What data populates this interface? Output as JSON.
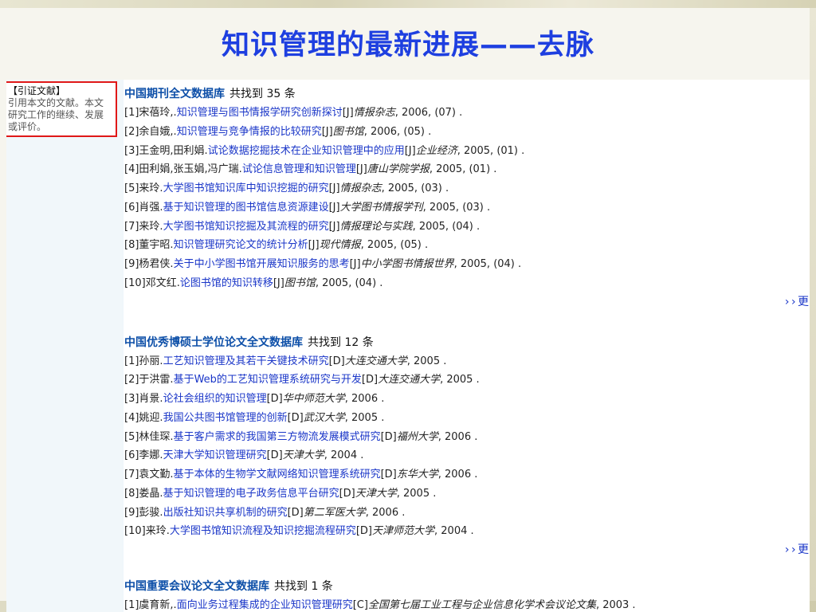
{
  "slide": {
    "title": "知识管理的最新进展——去脉"
  },
  "callout": {
    "title": "【引证文献】",
    "text": "引用本文的文献。本文研究工作的继续、发展或评价。"
  },
  "sections": [
    {
      "db_name": "中国期刊全文数据库",
      "found": "共找到 35 条",
      "items": [
        {
          "n": "[1]",
          "author": "宋蓓玲,.",
          "title": "知识管理与图书情报学研究创新探讨",
          "type": "[J]",
          "source": "情报杂志",
          "year": ", 2006, (07) ."
        },
        {
          "n": "[2]",
          "author": "余自娥,.",
          "title": "知识管理与竞争情报的比较研究",
          "type": "[J]",
          "source": "图书馆",
          "year": ", 2006, (05) ."
        },
        {
          "n": "[3]",
          "author": "王金明,田利娟.",
          "title": "试论数据挖掘技术在企业知识管理中的应用",
          "type": "[J]",
          "source": "企业经济",
          "year": ", 2005, (01) ."
        },
        {
          "n": "[4]",
          "author": "田利娟,张玉娟,冯广瑞.",
          "title": "试论信息管理和知识管理",
          "type": "[J]",
          "source": "唐山学院学报",
          "year": ", 2005, (01) ."
        },
        {
          "n": "[5]",
          "author": "来玲.",
          "title": "大学图书馆知识库中知识挖掘的研究",
          "type": "[J]",
          "source": "情报杂志",
          "year": ", 2005, (03) ."
        },
        {
          "n": "[6]",
          "author": "肖强.",
          "title": "基于知识管理的图书馆信息资源建设",
          "type": "[J]",
          "source": "大学图书情报学刊",
          "year": ", 2005, (03) ."
        },
        {
          "n": "[7]",
          "author": "来玲.",
          "title": "大学图书馆知识挖掘及其流程的研究",
          "type": "[J]",
          "source": "情报理论与实践",
          "year": ", 2005, (04) ."
        },
        {
          "n": "[8]",
          "author": "董宇昭.",
          "title": "知识管理研究论文的统计分析",
          "type": "[J]",
          "source": "现代情报",
          "year": ", 2005, (05) ."
        },
        {
          "n": "[9]",
          "author": "杨君侠.",
          "title": "关于中小学图书馆开展知识服务的思考",
          "type": "[J]",
          "source": "中小学图书情报世界",
          "year": ", 2005, (04) ."
        },
        {
          "n": "[10]",
          "author": "邓文红.",
          "title": "论图书馆的知识转移",
          "type": "[J]",
          "source": "图书馆",
          "year": ", 2005, (04) ."
        }
      ],
      "more": "› › 更"
    },
    {
      "db_name": "中国优秀博硕士学位论文全文数据库",
      "found": "共找到 12 条",
      "items": [
        {
          "n": "[1]",
          "author": "孙丽.",
          "title": "工艺知识管理及其若干关键技术研究",
          "type": "[D]",
          "source": "大连交通大学",
          "year": ", 2005 ."
        },
        {
          "n": "[2]",
          "author": "于洪雷.",
          "title": "基于Web的工艺知识管理系统研究与开发",
          "type": "[D]",
          "source": "大连交通大学",
          "year": ", 2005 ."
        },
        {
          "n": "[3]",
          "author": "肖景.",
          "title": "论社会组织的知识管理",
          "type": "[D]",
          "source": "华中师范大学",
          "year": ", 2006 ."
        },
        {
          "n": "[4]",
          "author": "姚迎.",
          "title": "我国公共图书馆管理的创新",
          "type": "[D]",
          "source": "武汉大学",
          "year": ", 2005 ."
        },
        {
          "n": "[5]",
          "author": "林佳琛.",
          "title": "基于客户需求的我国第三方物流发展模式研究",
          "type": "[D]",
          "source": "福州大学",
          "year": ", 2006 ."
        },
        {
          "n": "[6]",
          "author": "李娜.",
          "title": "天津大学知识管理研究",
          "type": "[D]",
          "source": "天津大学",
          "year": ", 2004 ."
        },
        {
          "n": "[7]",
          "author": "袁文勤.",
          "title": "基于本体的生物学文献网络知识管理系统研究",
          "type": "[D]",
          "source": "东华大学",
          "year": ", 2006 ."
        },
        {
          "n": "[8]",
          "author": "娄晶.",
          "title": "基于知识管理的电子政务信息平台研究",
          "type": "[D]",
          "source": "天津大学",
          "year": ", 2005 ."
        },
        {
          "n": "[9]",
          "author": "彭骏.",
          "title": "出版社知识共享机制的研究",
          "type": "[D]",
          "source": "第二军医大学",
          "year": ", 2006 ."
        },
        {
          "n": "[10]",
          "author": "来玲.",
          "title": "大学图书馆知识流程及知识挖掘流程研究",
          "type": "[D]",
          "source": "天津师范大学",
          "year": ", 2004 ."
        }
      ],
      "more": "› › 更"
    },
    {
      "db_name": "中国重要会议论文全文数据库",
      "found": "共找到 1 条",
      "items": [
        {
          "n": "[1]",
          "author": "虞育新,.",
          "title": "面向业务过程集成的企业知识管理研究",
          "type": "[C]",
          "source": "全国第七届工业工程与企业信息化学术会议论文集",
          "year": ", 2003 ."
        }
      ]
    }
  ],
  "colors": {
    "title": "#1e3fe0",
    "db_name": "#0d4fa8",
    "link": "#1a36c8",
    "callout_border": "#e01818"
  }
}
